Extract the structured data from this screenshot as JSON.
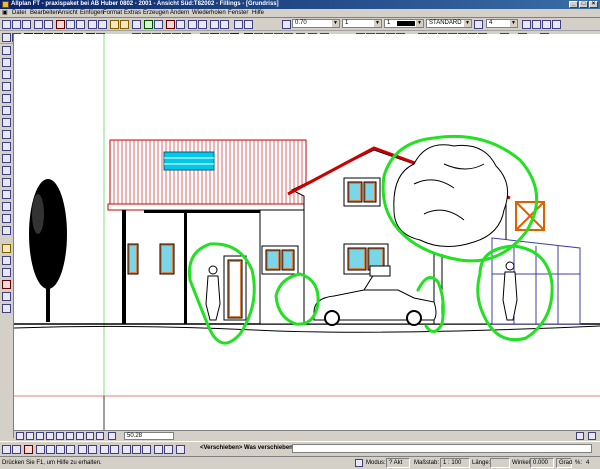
{
  "window": {
    "title": "Allplan FT - praxispaket bei AB Huber 0802 - 2001 - Ansicht Süd:T82002 - Fillings - [Grundriss]"
  },
  "menu": [
    "Datei",
    "Bearbeiten",
    "Ansicht",
    "Einfügen",
    "Format",
    "Extras",
    "Erzeugen",
    "Ändern",
    "Wiederholen",
    "Fenster",
    "Hilfe"
  ],
  "format_toolbar": {
    "pen_thickness": "0.70",
    "line_type": "1",
    "line_color": "1",
    "layer": "STANDARD",
    "pen_count": "4"
  },
  "navigation": {
    "zoom_value": "50.28"
  },
  "command_bar": {
    "prompt": "<Verschieben> Was verschieben?"
  },
  "status": {
    "help_text": "Drücken Sie F1, um Hilfe zu erhalten.",
    "modus_label": "Modus:",
    "modus_value": "? Akt",
    "massstab_label": "Maßstab:",
    "massstab_value": "1 : 100",
    "laenge_label": "Länge:",
    "winkel_label": "Winkel:",
    "winkel_value": "0.000",
    "unit": "Grad",
    "percent_label": "%:",
    "percent_value": "4"
  },
  "colors": {
    "title_start": "#0a246a",
    "title_end": "#3a6ea5",
    "chrome": "#d4d0c8",
    "markup_green": "#22e022",
    "cad_red": "#cc0000",
    "cad_cyan": "#00c8e8",
    "cad_orange": "#e06000"
  },
  "drawing": {
    "description_icons": [
      "tree-icon",
      "car-icon",
      "person-icon",
      "window-icon"
    ]
  }
}
